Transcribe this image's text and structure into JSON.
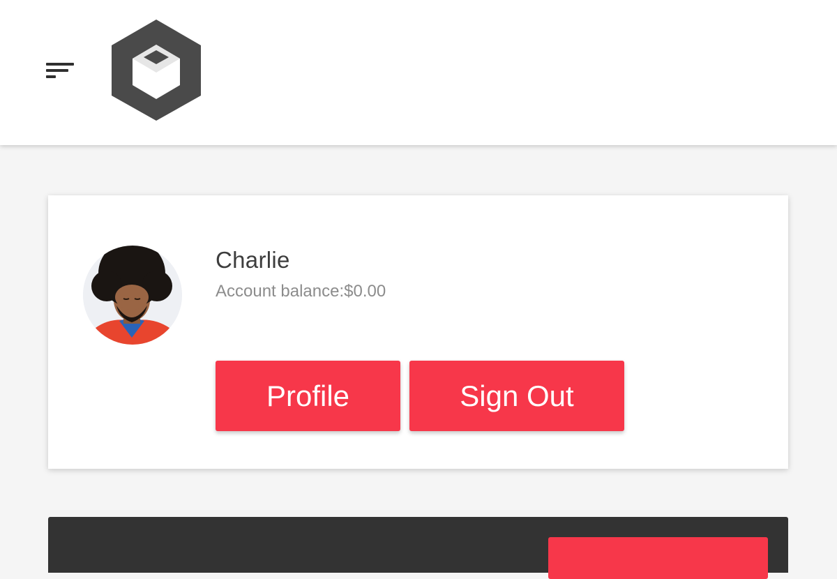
{
  "header": {
    "menu_icon": "hamburger-menu-icon",
    "logo_icon": "hexagon-cube-logo-icon"
  },
  "profile_card": {
    "avatar_icon": "user-avatar-photo",
    "user_name": "Charlie",
    "balance_label": "Account balance:$0.00",
    "profile_button_label": "Profile",
    "sign_out_button_label": "Sign Out"
  },
  "colors": {
    "accent": "#f7374a",
    "header_bg": "#ffffff",
    "page_bg": "#f5f5f5",
    "dark_panel_bg": "#333333"
  }
}
